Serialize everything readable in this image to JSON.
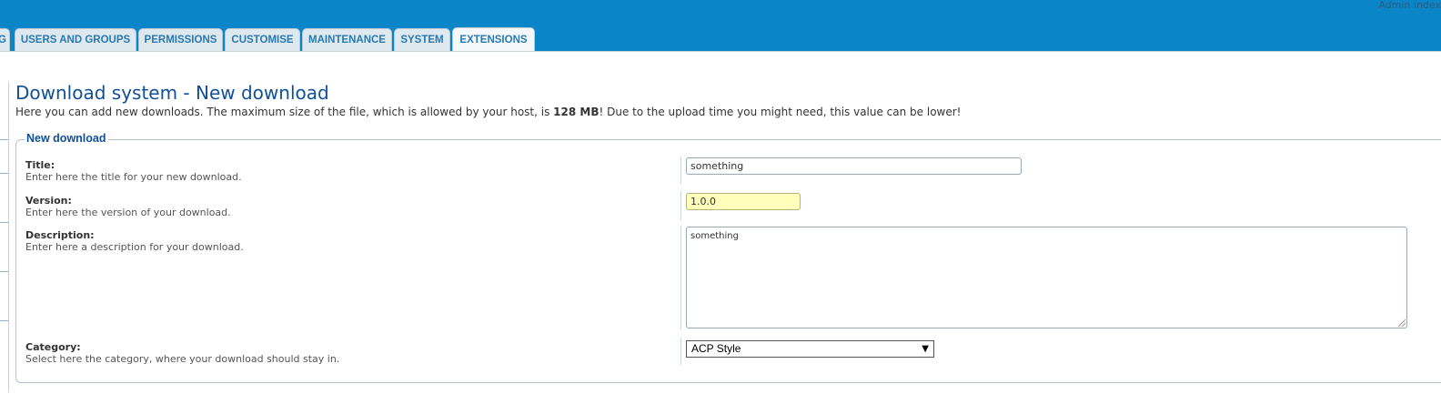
{
  "header": {
    "admin_index": "Admin index"
  },
  "tabs": [
    {
      "label": "G"
    },
    {
      "label": "USERS AND GROUPS"
    },
    {
      "label": "PERMISSIONS"
    },
    {
      "label": "CUSTOMISE"
    },
    {
      "label": "MAINTENANCE"
    },
    {
      "label": "SYSTEM"
    },
    {
      "label": "EXTENSIONS",
      "active": true
    }
  ],
  "page": {
    "title": "Download system - New download",
    "desc_before": "Here you can add new downloads. The maximum size of the file, which is allowed by your host, is ",
    "desc_size": "128 MB",
    "desc_after": "! Due to the upload time you might need, this value can be lower!"
  },
  "form": {
    "legend": "New download",
    "title": {
      "label": "Title:",
      "explain": "Enter here the title for your new download.",
      "value": "something"
    },
    "version": {
      "label": "Version:",
      "explain": "Enter here the version of your download.",
      "value": "1.0.0"
    },
    "description": {
      "label": "Description:",
      "explain": "Enter here a description for your download.",
      "value": "something"
    },
    "category": {
      "label": "Category:",
      "explain": "Select here the category, where your download should stay in.",
      "value": "ACP Style"
    }
  },
  "colors": {
    "header_bg": "#0a86c8",
    "title": "#115098",
    "tab_text": "#2a79b0",
    "highlight_input": "#ffffbb"
  },
  "icons": {
    "select_arrow": "triangle-down-icon"
  }
}
